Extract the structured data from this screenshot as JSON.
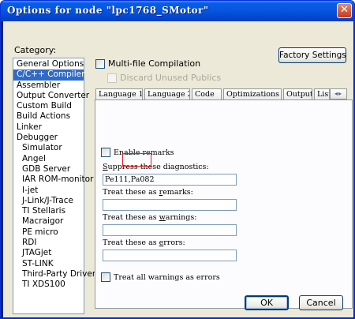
{
  "window": {
    "title": "Options for node \"lpc1768_SMotor\""
  },
  "category": {
    "label": "Category:",
    "items": [
      {
        "label": "General Options",
        "sub": false,
        "selected": false
      },
      {
        "label": "C/C++ Compiler",
        "sub": false,
        "selected": true
      },
      {
        "label": "Assembler",
        "sub": false,
        "selected": false
      },
      {
        "label": "Output Converter",
        "sub": false,
        "selected": false
      },
      {
        "label": "Custom Build",
        "sub": false,
        "selected": false
      },
      {
        "label": "Build Actions",
        "sub": false,
        "selected": false
      },
      {
        "label": "Linker",
        "sub": false,
        "selected": false
      },
      {
        "label": "Debugger",
        "sub": false,
        "selected": false
      },
      {
        "label": "Simulator",
        "sub": true,
        "selected": false
      },
      {
        "label": "Angel",
        "sub": true,
        "selected": false
      },
      {
        "label": "GDB Server",
        "sub": true,
        "selected": false
      },
      {
        "label": "IAR ROM-monitor",
        "sub": true,
        "selected": false
      },
      {
        "label": "I-jet",
        "sub": true,
        "selected": false
      },
      {
        "label": "J-Link/J-Trace",
        "sub": true,
        "selected": false
      },
      {
        "label": "TI Stellaris",
        "sub": true,
        "selected": false
      },
      {
        "label": "Macraigor",
        "sub": true,
        "selected": false
      },
      {
        "label": "PE micro",
        "sub": true,
        "selected": false
      },
      {
        "label": "RDI",
        "sub": true,
        "selected": false
      },
      {
        "label": "JTAGjet",
        "sub": true,
        "selected": false
      },
      {
        "label": "ST-LINK",
        "sub": true,
        "selected": false
      },
      {
        "label": "Third-Party Driver",
        "sub": true,
        "selected": false
      },
      {
        "label": "TI XDS100",
        "sub": true,
        "selected": false
      }
    ]
  },
  "factory_settings_label": "Factory Settings",
  "multi_file": {
    "label": "Multi-file Compilation",
    "checked": false
  },
  "discard_unused": {
    "label": "Discard Unused Publics",
    "checked": false,
    "disabled": true
  },
  "tabs": [
    "Language 1",
    "Language 2",
    "Code",
    "Optimizations",
    "Output",
    "List"
  ],
  "tab_scroll_icon": "◂▸",
  "diagnostics": {
    "enable_remarks": {
      "label": "Enable remarks",
      "checked": false
    },
    "suppress": {
      "label": "Suppress these diagnostics:",
      "value": "Pe111,Pa082"
    },
    "treat_remarks": {
      "label": "Treat these as remarks:",
      "value": ""
    },
    "treat_warnings": {
      "label": "Treat these as warnings:",
      "value": ""
    },
    "treat_errors": {
      "label": "Treat these as errors:",
      "value": ""
    },
    "all_warnings_errors": {
      "label": "Treat all warnings as errors",
      "checked": false
    }
  },
  "buttons": {
    "ok": "OK",
    "cancel": "Cancel"
  },
  "colors": {
    "titlebar": "#0555e0",
    "selection": "#316ac5",
    "dialog_bg": "#ece9d8",
    "highlight": "#e02020"
  }
}
